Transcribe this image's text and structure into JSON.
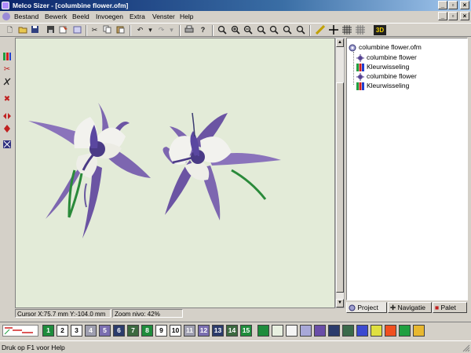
{
  "window": {
    "title": "Melco Sizer - [columbine flower.ofm]"
  },
  "caption_buttons": {
    "minimize": "_",
    "maximize": "▫",
    "close": "×"
  },
  "menu": [
    "Bestand",
    "Bewerk",
    "Beeld",
    "Invoegen",
    "Extra",
    "Venster",
    "Help"
  ],
  "toolbar": {
    "badge_3d": "3D",
    "icons": [
      "new-file-icon",
      "open-folder-icon",
      "save-icon",
      "disk-icon",
      "properties-icon",
      "cut-icon",
      "copy-icon",
      "paste-icon",
      "undo-icon",
      "redo-icon",
      "print-icon",
      "help-icon",
      "zoom-all-icon",
      "zoom-in-icon",
      "zoom-out-icon",
      "zoom-window-icon",
      "zoom-fit-icon",
      "zoom-previous-icon",
      "zoom-actual-icon",
      "measure-icon",
      "crosshair-icon",
      "grid-icon",
      "hoop-grid-icon"
    ]
  },
  "canvas": {
    "background": "#e3ebd8"
  },
  "status_canvas": {
    "cursor": "Cursor X:75.7 mm Y:-104.0 mm",
    "zoom": "Zoom nivo: 42%"
  },
  "tree": {
    "root": "columbine flower.ofm",
    "items": [
      "columbine flower",
      "Kleurwisseling",
      "columbine flower",
      "Kleurwisseling"
    ]
  },
  "tabs": [
    "Project",
    "Navigatie",
    "Palet"
  ],
  "palette": {
    "swatches": [
      {
        "label": "1",
        "color": "#1e8c3c"
      },
      {
        "label": "2",
        "color": "#ffffff"
      },
      {
        "label": "3",
        "color": "#ffffff"
      },
      {
        "label": "4",
        "color": "#9f9fb0"
      },
      {
        "label": "5",
        "color": "#7a6eb0"
      },
      {
        "label": "6",
        "color": "#2c3c6c"
      },
      {
        "label": "7",
        "color": "#3c6a40"
      },
      {
        "label": "8",
        "color": "#1e8c3c"
      },
      {
        "label": "9",
        "color": "#ffffff"
      },
      {
        "label": "10",
        "color": "#ffffff"
      },
      {
        "label": "11",
        "color": "#9f9fb0"
      },
      {
        "label": "12",
        "color": "#7a6eb0"
      },
      {
        "label": "13",
        "color": "#2c3c6c"
      },
      {
        "label": "14",
        "color": "#3c6a40"
      },
      {
        "label": "15",
        "color": "#1e8c3c"
      }
    ],
    "extra_colors": [
      "#1e8c3c",
      "#e8f0e0",
      "#f4f4f4",
      "#a8a8d8",
      "#6a4ea8",
      "#2c3c6c",
      "#3a6a4a",
      "#3c4ad0",
      "#e0e040",
      "#f05020",
      "#20a040",
      "#e8b830"
    ]
  },
  "statusbar": {
    "help": "Druk op F1 voor Help"
  }
}
